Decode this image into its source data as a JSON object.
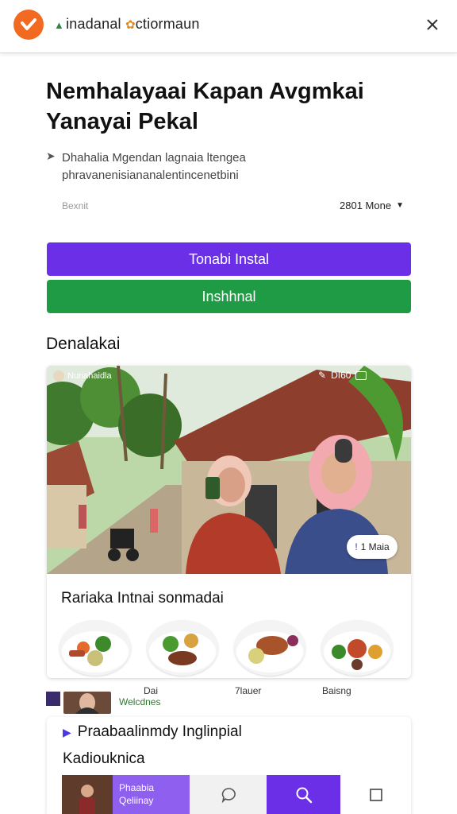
{
  "header": {
    "app_name": "inadanal",
    "app_name_suffix": "ctiormaun",
    "accent": "#f26a22",
    "close_icon": "close-icon"
  },
  "main": {
    "title": "Nemhalayaai Kapan Avgmkai Yanayai Pekal",
    "description": "Dhahalia Mgendan lagnaia ltengea phravanenisiananalentincenetbini",
    "meta_left": "Bexnit",
    "meta_right": "2801 Mone",
    "primary_button": "Tonabi Instal",
    "secondary_button": "Inshhnal",
    "section_title": "Denalakai"
  },
  "card": {
    "chip_left": "Nunahaidla",
    "chip_right": "DI60",
    "badge": "1 Maia",
    "caption": "Rariaka Intnai sonmadai",
    "dish_labels": [
      "Dai",
      "7lauer",
      "Baisng"
    ]
  },
  "mini": {
    "label": "Welcdnes"
  },
  "bottom": {
    "title": "Praabaalinmdy Inglinpial",
    "subtitle": "Kadiouknica",
    "promo_line1": "Phaabia",
    "promo_line2": "Qeliinay"
  },
  "colors": {
    "primary": "#6a2fe6",
    "secondary": "#1f9a45",
    "promo": "#8f5ff0"
  }
}
